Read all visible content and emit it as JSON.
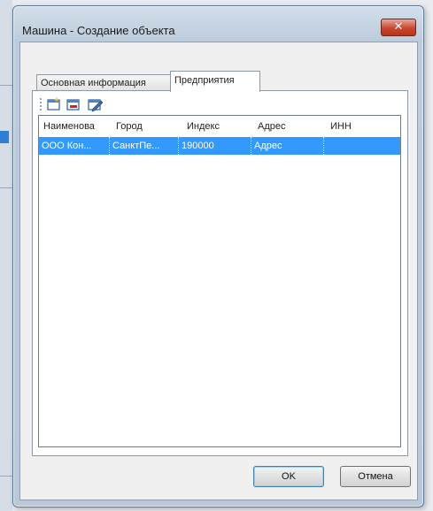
{
  "window": {
    "title": "Машина - Создание объекта",
    "close_glyph": "✕"
  },
  "tabs": [
    {
      "label": "Основная информация",
      "active": false
    },
    {
      "label": "Предприятия",
      "active": true
    }
  ],
  "toolbar": {
    "icons": [
      "new-record-icon",
      "delete-record-icon",
      "edit-record-icon"
    ]
  },
  "grid": {
    "columns": [
      "Наименова",
      "Город",
      "Индекс",
      "Адрес",
      "ИНН"
    ],
    "rows": [
      {
        "name": "ООО Кон...",
        "city": "СанктПе...",
        "index": "190000",
        "address": "Адрес",
        "inn": ""
      }
    ]
  },
  "buttons": {
    "ok_label": "OK",
    "cancel_label": "Отмена"
  },
  "colors": {
    "selection": "#3399ff",
    "close_button": "#c8452e"
  }
}
